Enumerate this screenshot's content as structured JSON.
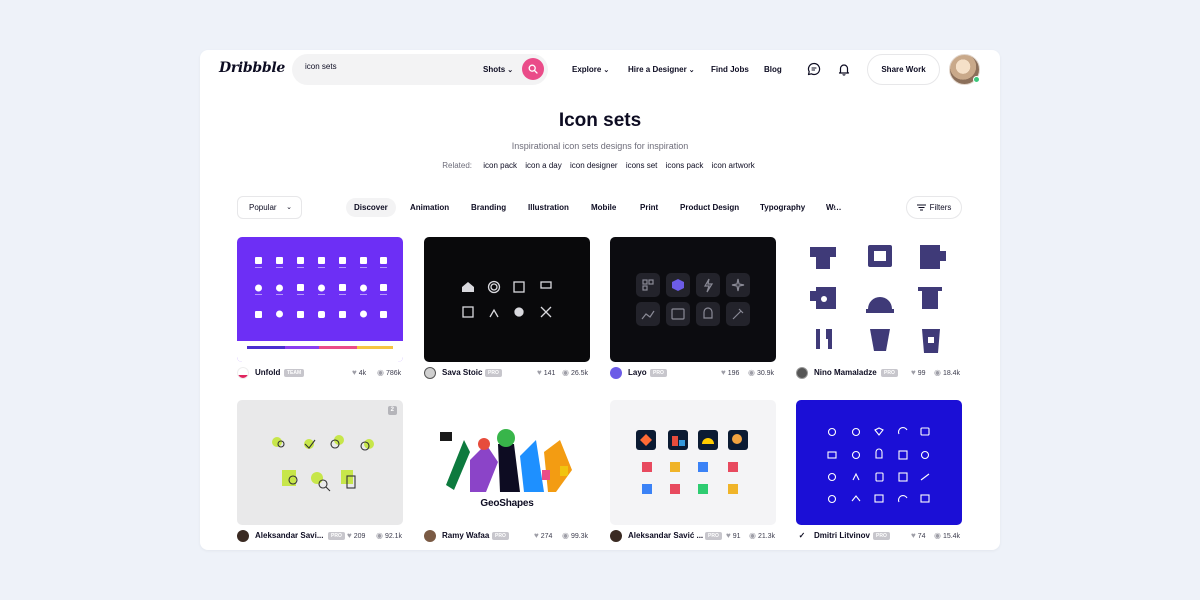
{
  "nav": {
    "logo": "Dribbble",
    "search_value": "icon sets",
    "search_scope": "Shots",
    "explore": "Explore",
    "hire": "Hire a Designer",
    "find_jobs": "Find Jobs",
    "blog": "Blog",
    "share": "Share Work"
  },
  "hero": {
    "title": "Icon sets",
    "subtitle": "Inspirational icon sets designs for inspiration",
    "related_label": "Related:",
    "related": [
      "icon pack",
      "icon a day",
      "icon designer",
      "icons set",
      "icons pack",
      "icon artwork"
    ]
  },
  "filters": {
    "sort": "Popular",
    "categories": [
      "Discover",
      "Animation",
      "Branding",
      "Illustration",
      "Mobile",
      "Print",
      "Product Design",
      "Typography"
    ],
    "more": "W…",
    "filters_label": "Filters"
  },
  "shots": [
    {
      "name": "Unfold",
      "badge": "TEAM",
      "likes": "4k",
      "views": "786k"
    },
    {
      "name": "Sava Stoic",
      "badge": "PRO",
      "likes": "141",
      "views": "26.5k"
    },
    {
      "name": "Layo",
      "badge": "PRO",
      "likes": "196",
      "views": "30.9k"
    },
    {
      "name": "Nino Mamaladze",
      "badge": "PRO",
      "likes": "99",
      "views": "18.4k"
    },
    {
      "name": "Aleksandar Savi...",
      "badge": "PRO",
      "likes": "209",
      "views": "92.1k"
    },
    {
      "name": "Ramy Wafaa",
      "badge": "PRO",
      "likes": "274",
      "views": "99.3k"
    },
    {
      "name": "Aleksandar Savić ...",
      "badge": "PRO",
      "likes": "91",
      "views": "21.3k"
    },
    {
      "name": "Dmitri Litvinov",
      "badge": "PRO",
      "likes": "74",
      "views": "15.4k"
    }
  ],
  "thumb_text": {
    "geoshapes": "GeoShapes",
    "count_badge": "2"
  },
  "colors": {
    "brand_pink": "#ea4c89",
    "purple_thumb": "#6d2ff5",
    "blue_thumb": "#1b0fd6",
    "dark_thumb": "#09090b",
    "icon_navy": "#3f3a78"
  }
}
